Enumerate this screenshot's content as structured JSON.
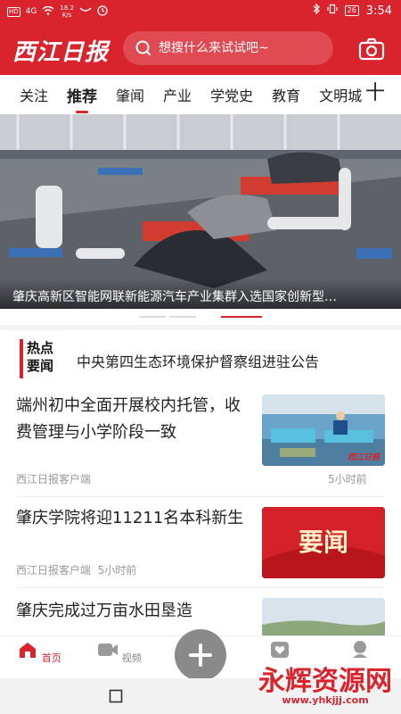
{
  "status_bar": {
    "network_badge": "HD",
    "signal": "4G",
    "speed": "18.2",
    "speed_unit": "K/s",
    "battery": "26",
    "time": "3:54"
  },
  "header": {
    "logo_text": "西江日报",
    "search_placeholder": "想搜什么来试试吧~",
    "camera_icon": "camera-icon",
    "brand_color": "#d9232d"
  },
  "tabs": [
    {
      "label": "关注",
      "active": false
    },
    {
      "label": "推荐",
      "active": true
    },
    {
      "label": "肇闻",
      "active": false
    },
    {
      "label": "产业",
      "active": false
    },
    {
      "label": "学党史",
      "active": false
    },
    {
      "label": "教育",
      "active": false
    },
    {
      "label": "文明城",
      "active": false
    }
  ],
  "tab_add_label": "十",
  "banner": {
    "caption": "肇庆高新区智能网联新能源汽车产业集群入选国家创新型…",
    "slides": 3,
    "active_slide": 3
  },
  "hot_news": {
    "label_line1": "热点",
    "label_line2": "要闻",
    "text": "中央第四生态环境保护督察组进驻公告"
  },
  "news": [
    {
      "title": "端州初中全面开展校内托管，收费管理与小学阶段一致",
      "source": "西江日报客户端",
      "time": "5小时前",
      "thumb_badge": "西江日报"
    },
    {
      "title": "肇庆学院将迎11211名本科新生",
      "source": "西江日报客户端",
      "time": "5小时前",
      "thumb_text": "要闻"
    },
    {
      "title": "肇庆完成过万亩水田垦造",
      "source": "",
      "time": ""
    }
  ],
  "bottom_nav": [
    {
      "label": "首页",
      "icon": "home-icon",
      "active": true
    },
    {
      "label": "视频",
      "icon": "video-icon",
      "active": false
    },
    {
      "label": "",
      "icon": "plus-icon",
      "active": false
    },
    {
      "label": "",
      "icon": "heart-icon",
      "active": false
    },
    {
      "label": "",
      "icon": "profile-icon",
      "active": false
    }
  ],
  "watermark": {
    "text": "永辉资源网",
    "sub": "www.yhkjjj.com"
  }
}
